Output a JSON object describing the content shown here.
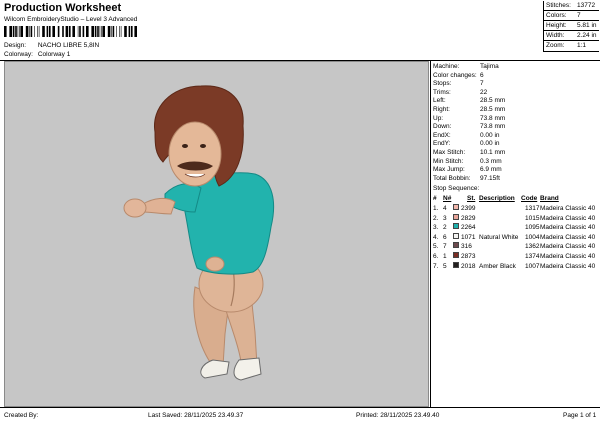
{
  "header": {
    "title": "Production Worksheet",
    "subtitle": "Wilcom EmbroideryStudio – Level 3 Advanced",
    "design_label": "Design:",
    "design_value": "NACHO LIBRE 5,8IN",
    "colorway_label": "Colorway:",
    "colorway_value": "Colorway 1"
  },
  "stats": [
    {
      "label": "Stitches:",
      "value": "13772"
    },
    {
      "label": "Colors:",
      "value": "7"
    },
    {
      "label": "Height:",
      "value": "5.81 in"
    },
    {
      "label": "Width:",
      "value": "2.24 in"
    },
    {
      "label": "Zoom:",
      "value": "1:1"
    }
  ],
  "machine": [
    {
      "label": "Machine:",
      "value": "Tajima"
    },
    {
      "label": "Color changes:",
      "value": "6"
    },
    {
      "label": "Stops:",
      "value": "7"
    },
    {
      "label": "Trims:",
      "value": "22"
    },
    {
      "label": "Left:",
      "value": "28.5 mm"
    },
    {
      "label": "Right:",
      "value": "28.5 mm"
    },
    {
      "label": "Up:",
      "value": "73.8 mm"
    },
    {
      "label": "Down:",
      "value": "73.8 mm"
    },
    {
      "label": "EndX:",
      "value": "0.00 in"
    },
    {
      "label": "EndY:",
      "value": "0.00 in"
    },
    {
      "label": "Max Stitch:",
      "value": "10.1 mm"
    },
    {
      "label": "Min Stitch:",
      "value": "0.3 mm"
    },
    {
      "label": "Max Jump:",
      "value": "6.9 mm"
    },
    {
      "label": "Total Bobbin:",
      "value": "97.15ft"
    }
  ],
  "sequence": {
    "title": "Stop Sequence:",
    "headers": {
      "num": "#",
      "n": "N#",
      "st": "St.",
      "desc": "Description",
      "code": "Code",
      "brand": "Brand"
    },
    "rows": [
      {
        "num": "1.",
        "n": "4",
        "color": "#f2b7ac",
        "st": "2399",
        "desc": "",
        "code": "1317",
        "brand": "Madeira Classic 40"
      },
      {
        "num": "2.",
        "n": "3",
        "color": "#e8a59a",
        "st": "2829",
        "desc": "",
        "code": "1015",
        "brand": "Madeira Classic 40"
      },
      {
        "num": "3.",
        "n": "2",
        "color": "#1fb0ac",
        "st": "2264",
        "desc": "",
        "code": "1095",
        "brand": "Madeira Classic 40"
      },
      {
        "num": "4.",
        "n": "6",
        "color": "#f4f4f2",
        "st": "1071",
        "desc": "Natural White",
        "code": "1004",
        "brand": "Madeira Classic 40"
      },
      {
        "num": "5.",
        "n": "7",
        "color": "#6c4a4e",
        "st": "316",
        "desc": "",
        "code": "1362",
        "brand": "Madeira Classic 40"
      },
      {
        "num": "6.",
        "n": "1",
        "color": "#7a2e24",
        "st": "2873",
        "desc": "",
        "code": "1374",
        "brand": "Madeira Classic 40"
      },
      {
        "num": "7.",
        "n": "5",
        "color": "#231f1e",
        "st": "2018",
        "desc": "Amber Black",
        "code": "1007",
        "brand": "Madeira Classic 40"
      }
    ]
  },
  "footer": {
    "created": "Created By:",
    "saved": "Last Saved: 28/11/2025 23.49.37",
    "printed": "Printed: 28/11/2025 23.49.40",
    "page": "Page 1 of 1"
  }
}
